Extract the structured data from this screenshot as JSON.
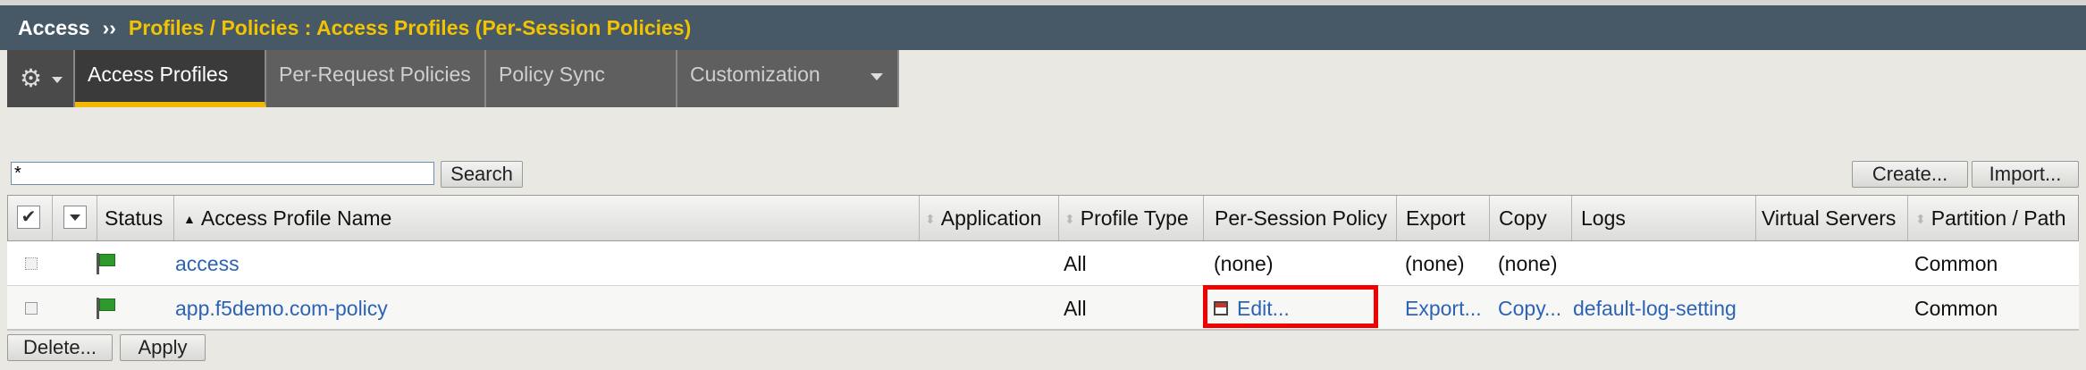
{
  "breadcrumb": {
    "root": "Access",
    "separator": "››",
    "current": "Profiles / Policies : Access Profiles (Per-Session Policies)"
  },
  "tabs": [
    {
      "label": "Access Profiles",
      "active": true
    },
    {
      "label": "Per-Request Policies",
      "active": false
    },
    {
      "label": "Policy Sync",
      "active": false
    },
    {
      "label": "Customization",
      "active": false,
      "has_dropdown": true
    }
  ],
  "search": {
    "value": "*",
    "button_label": "Search"
  },
  "actions": {
    "create_label": "Create...",
    "import_label": "Import..."
  },
  "table": {
    "columns": [
      "Status",
      "Access Profile Name",
      "Application",
      "Profile Type",
      "Per-Session Policy",
      "Export",
      "Copy",
      "Logs",
      "Virtual Servers",
      "Partition / Path"
    ],
    "rows": [
      {
        "name": "access",
        "application": "",
        "profile_type": "All",
        "policy": "(none)",
        "export": "(none)",
        "copy": "(none)",
        "logs": "",
        "virtual_servers": "",
        "partition": "Common"
      },
      {
        "name": "app.f5demo.com-policy",
        "application": "",
        "profile_type": "All",
        "policy": "Edit...",
        "export": "Export...",
        "copy": "Copy...",
        "logs": "default-log-setting",
        "virtual_servers": "",
        "partition": "Common"
      }
    ]
  },
  "footer": {
    "delete_label": "Delete...",
    "apply_label": "Apply"
  },
  "colors": {
    "titlebar": "#475867",
    "breadcrumb_accent": "#f2c400",
    "active_tab_underline": "#f5b800",
    "link": "#2d63b4",
    "highlight": "#f00000",
    "status_flag": "#2e9a2e"
  }
}
